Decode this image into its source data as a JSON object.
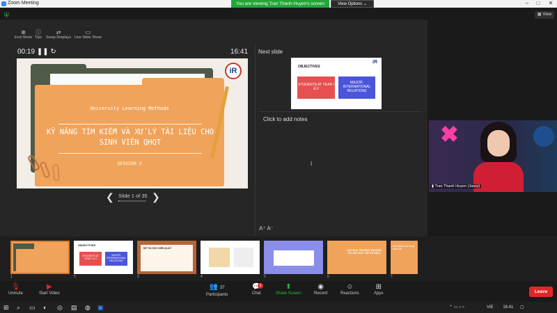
{
  "window": {
    "title": "Zoom Meeting"
  },
  "share_banner": {
    "text": "You are viewing Tran Thanh Huyen's screen",
    "view_options": "View Options ⌄"
  },
  "top": {
    "view_label": "View"
  },
  "presenter_toolbar": [
    {
      "label": "End Show",
      "icon": "end-show-icon"
    },
    {
      "label": "Tips",
      "icon": "info-icon"
    },
    {
      "label": "Swap Displays",
      "icon": "swap-icon"
    },
    {
      "label": "Use Slide Show",
      "icon": "monitor-icon"
    }
  ],
  "timer": "00:19",
  "clock": "16:41",
  "next_slide_label": "Next slide",
  "notes_placeholder": "Click to add notes",
  "slide": {
    "subtitle": "University Learning Methods",
    "title": "KỸ NĂNG TÌM KIẾM VÀ XỬ LÝ TÀI LIỆU CHO SINH VIÊN QHQT",
    "session": "SESSION 3",
    "logo_text": "iR"
  },
  "slide_nav": {
    "counter": "Slide 1 of 35",
    "progress": 0.029
  },
  "next_slide": {
    "heading": "OBJECTIVES",
    "box1": "STUDENTS AT YEAR I & II",
    "box2": "MAJOR: INTERNATIONAL RELATIONS",
    "logo_text": "iR"
  },
  "video": {
    "participant_name": "Tran Thanh Huyen (Jassy)"
  },
  "thumbnails": [
    {
      "num": "1",
      "bg": "#f0a35a"
    },
    {
      "num": "2",
      "bg": "#ffffff"
    },
    {
      "num": "3",
      "bg": "#b5643c"
    },
    {
      "num": "4",
      "bg": "#ffffff"
    },
    {
      "num": "5",
      "bg": "#8a8ee8"
    },
    {
      "num": "6",
      "bg": "#f0a35a"
    },
    {
      "num": "7",
      "bg": "#f0a35a"
    }
  ],
  "thumb_text": {
    "t2_heading": "OBJECTIVES",
    "t2_box1": "STUDENTS AT YEAR I & II",
    "t2_box2": "MAJOR: INTERNATIONAL RELATIONS",
    "t3_title": "ĐỀ TÀI HỌC NIÊN QUÁT",
    "t6_title": "CÁC ĐƯA TRƯỜNG TÌM KIẾM TÀI LIỆU HỌC TẬP TỪ ĐÂU?",
    "t7_title": "Các thành tựu trong quan hệ"
  },
  "toolbar": {
    "unmute": "Unmute",
    "start_video": "Start Video",
    "participants": "Participants",
    "participants_count": "37",
    "chat": "Chat",
    "chat_badge": "2",
    "share_screen": "Share Screen",
    "record": "Record",
    "reactions": "Reactions",
    "apps": "Apps",
    "leave": "Leave"
  },
  "taskbar": {
    "lang": "VIE",
    "time": "16:41"
  }
}
